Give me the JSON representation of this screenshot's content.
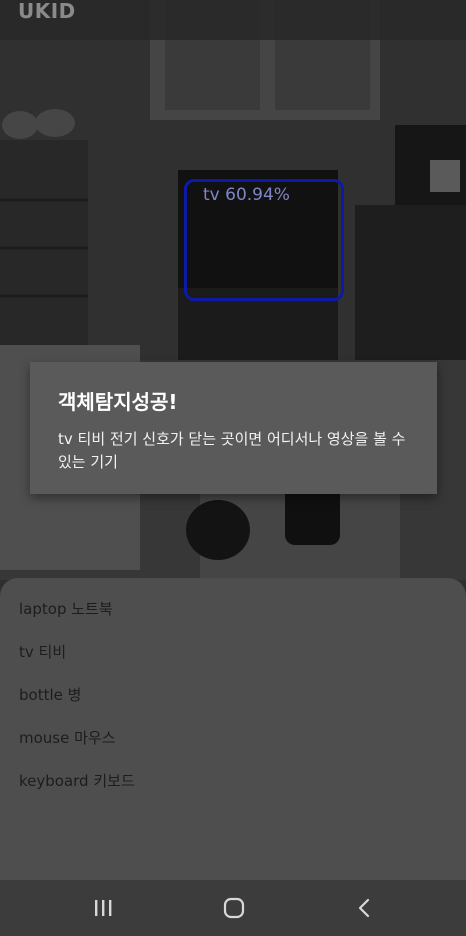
{
  "app": {
    "title": "UKID"
  },
  "detection": {
    "label": "tv 60.94%"
  },
  "dialog": {
    "title": "객체탐지성공!",
    "message": "tv 티비 전기 신호가 닫는 곳이면 어디서나 영상을 볼 수 있는 기기"
  },
  "sheet": {
    "items": [
      {
        "label": "laptop 노트북"
      },
      {
        "label": "tv 티비"
      },
      {
        "label": "bottle 병"
      },
      {
        "label": "mouse 마우스"
      },
      {
        "label": "keyboard 키보드"
      }
    ]
  },
  "navbar": {
    "recent": "recent-apps-icon",
    "home": "home-icon",
    "back": "back-icon"
  },
  "colors": {
    "detection_box": "#0d1aa6",
    "dialog_bg": "#5a5a5a",
    "sheet_bg": "#4e4e4e"
  }
}
